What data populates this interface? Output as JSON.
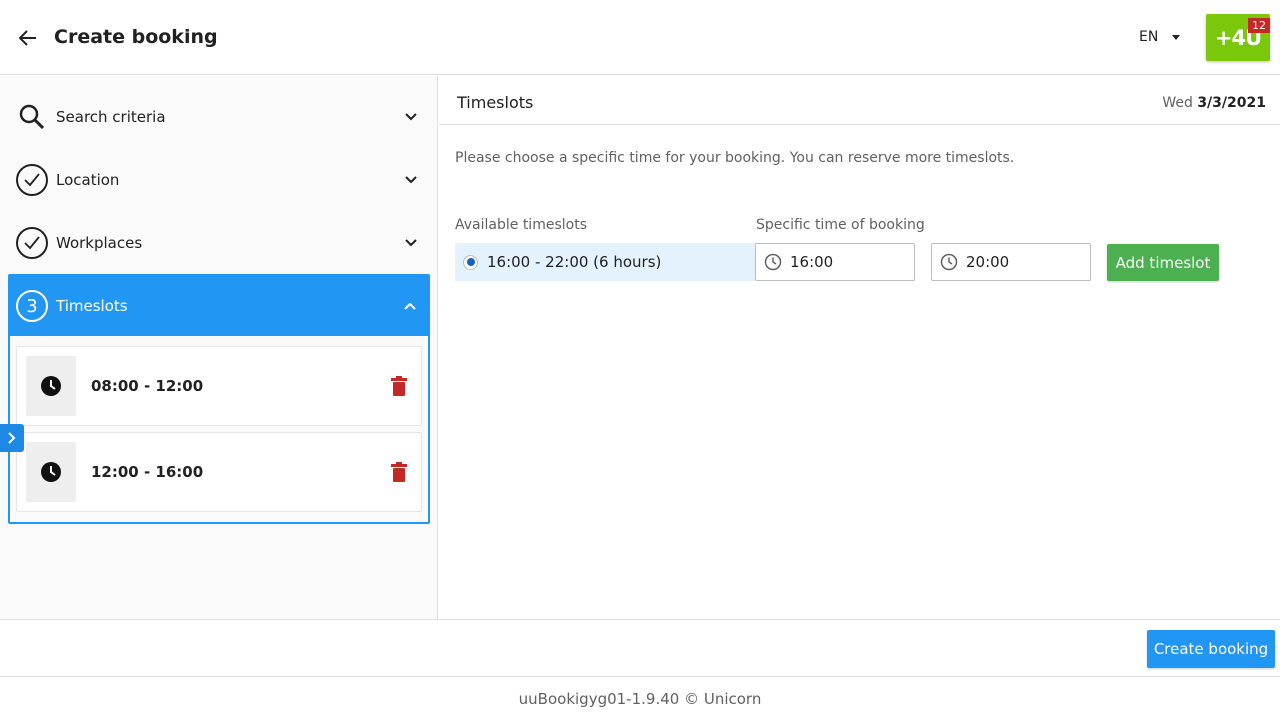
{
  "header": {
    "title": "Create booking",
    "language": "EN",
    "logo_text": "+4U",
    "notification_count": "12"
  },
  "sidebar": {
    "steps": [
      {
        "label": "Search criteria",
        "icon": "search-icon",
        "state": "collapsed"
      },
      {
        "label": "Location",
        "icon": "check-circle-icon",
        "state": "completed"
      },
      {
        "label": "Workplaces",
        "icon": "check-circle-icon",
        "state": "completed"
      }
    ],
    "active_step": {
      "number": "3",
      "label": "Timeslots",
      "timeslots": [
        {
          "time": "08:00 - 12:00"
        },
        {
          "time": "12:00 - 16:00"
        }
      ]
    }
  },
  "main": {
    "title": "Timeslots",
    "date_weekday": "Wed",
    "date_value": "3/3/2021",
    "hint": "Please choose a specific time for your booking. You can reserve more timeslots.",
    "available_label": "Available timeslots",
    "specific_label": "Specific time of booking",
    "available_slot": "16:00 - 22:00 (6 hours)",
    "from_time": "16:00",
    "to_time": "20:00",
    "add_button": "Add timeslot"
  },
  "actions": {
    "create_button": "Create booking"
  },
  "footer": {
    "text": "uuBookigyg01-1.9.40 © Unicorn"
  },
  "colors": {
    "accent": "#2196f3",
    "success": "#4caf50",
    "danger": "#c62828",
    "logo": "#7ac70c"
  }
}
